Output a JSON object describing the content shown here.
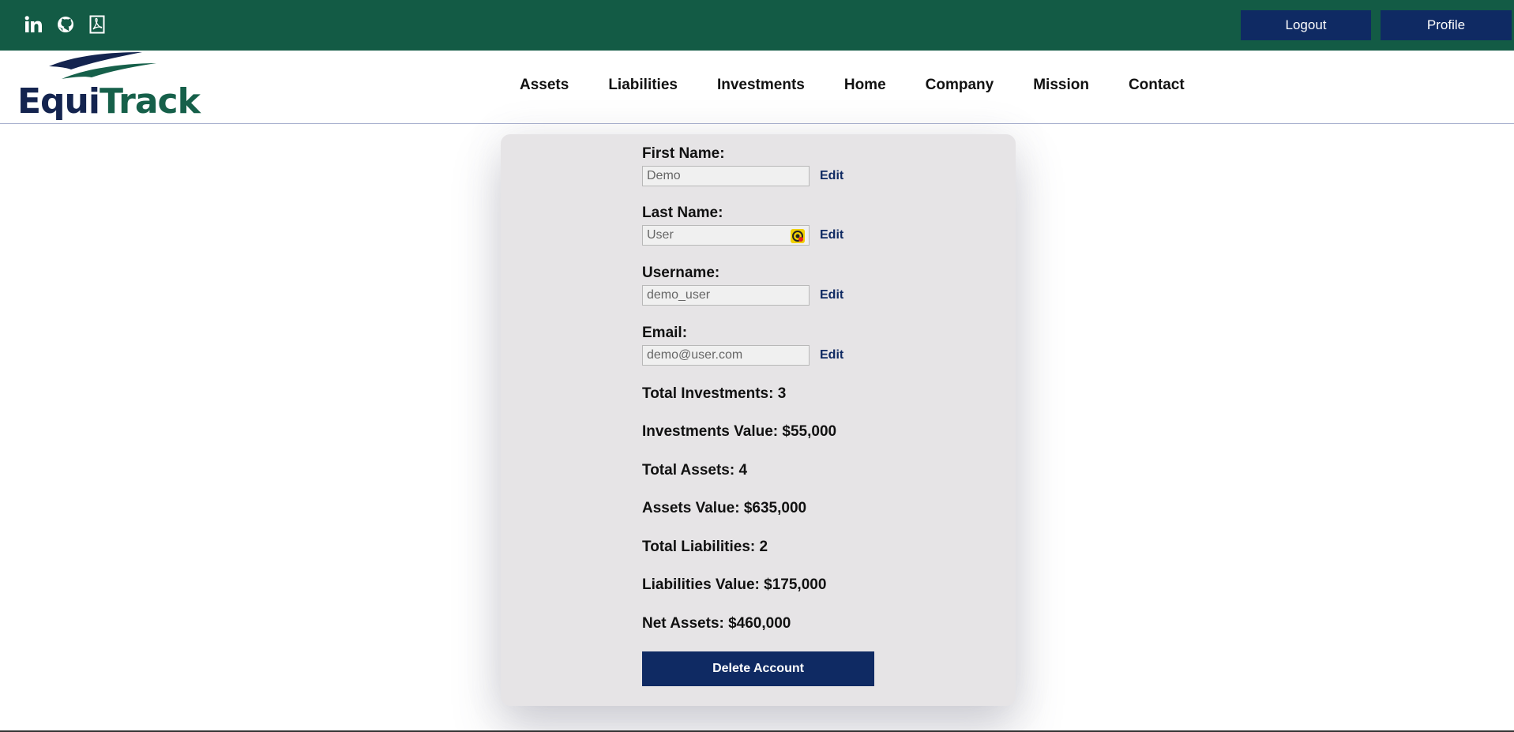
{
  "topbar": {
    "social": [
      "linkedin-icon",
      "github-icon",
      "pdf-icon"
    ],
    "logout_label": "Logout",
    "profile_label": "Profile"
  },
  "brand": {
    "part1": "Equi",
    "part2": "Track"
  },
  "nav": {
    "items": [
      "Assets",
      "Liabilities",
      "Investments",
      "Home",
      "Company",
      "Mission",
      "Contact"
    ]
  },
  "profile": {
    "fields": [
      {
        "label": "First Name:",
        "value": "Demo",
        "edit": "Edit"
      },
      {
        "label": "Last Name:",
        "value": "User",
        "edit": "Edit"
      },
      {
        "label": "Username:",
        "value": "demo_user",
        "edit": "Edit"
      },
      {
        "label": "Email:",
        "value": "demo@user.com",
        "edit": "Edit"
      }
    ],
    "stats": [
      "Total Investments: 3",
      "Investments Value: $55,000",
      "Total Assets: 4",
      "Assets Value: $635,000",
      "Total Liabilities: 2",
      "Liabilities Value: $175,000",
      "Net Assets: $460,000"
    ],
    "delete_label": "Delete Account"
  },
  "colors": {
    "topbar": "#135b45",
    "primary": "#0f2a63",
    "card": "#e6e4e6"
  }
}
